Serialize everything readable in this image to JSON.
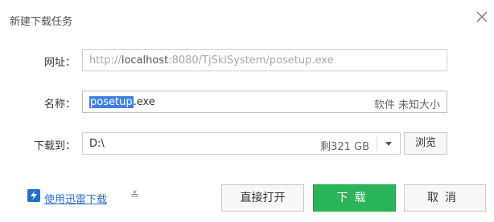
{
  "dialog": {
    "title": "新建下载任务",
    "close_icon": "close-icon"
  },
  "url_row": {
    "label": "网址：",
    "prefix": "http://",
    "host": "localhost",
    "rest": ":8080/TjSklSystem/posetup.exe"
  },
  "name_row": {
    "label": "名称：",
    "selected_part": "posetup",
    "extension": ".exe",
    "hint": "软件 未知大小"
  },
  "dir_row": {
    "label": "下载到：",
    "path": "D:\\",
    "free_space": "剩321 GB",
    "dropdown_icon": "chevron-down-icon",
    "browse_label": "浏览"
  },
  "footer": {
    "thunder_link": "使用迅雷下载",
    "thunder_icon": "thunder-icon",
    "expand_icon": "double-chevron-down-icon",
    "expand_glyph": "≚",
    "open_label": "直接打开",
    "download_label": "下载",
    "cancel_label": "取消",
    "download_color": "#2bb55a",
    "link_color": "#2d6fd2"
  }
}
